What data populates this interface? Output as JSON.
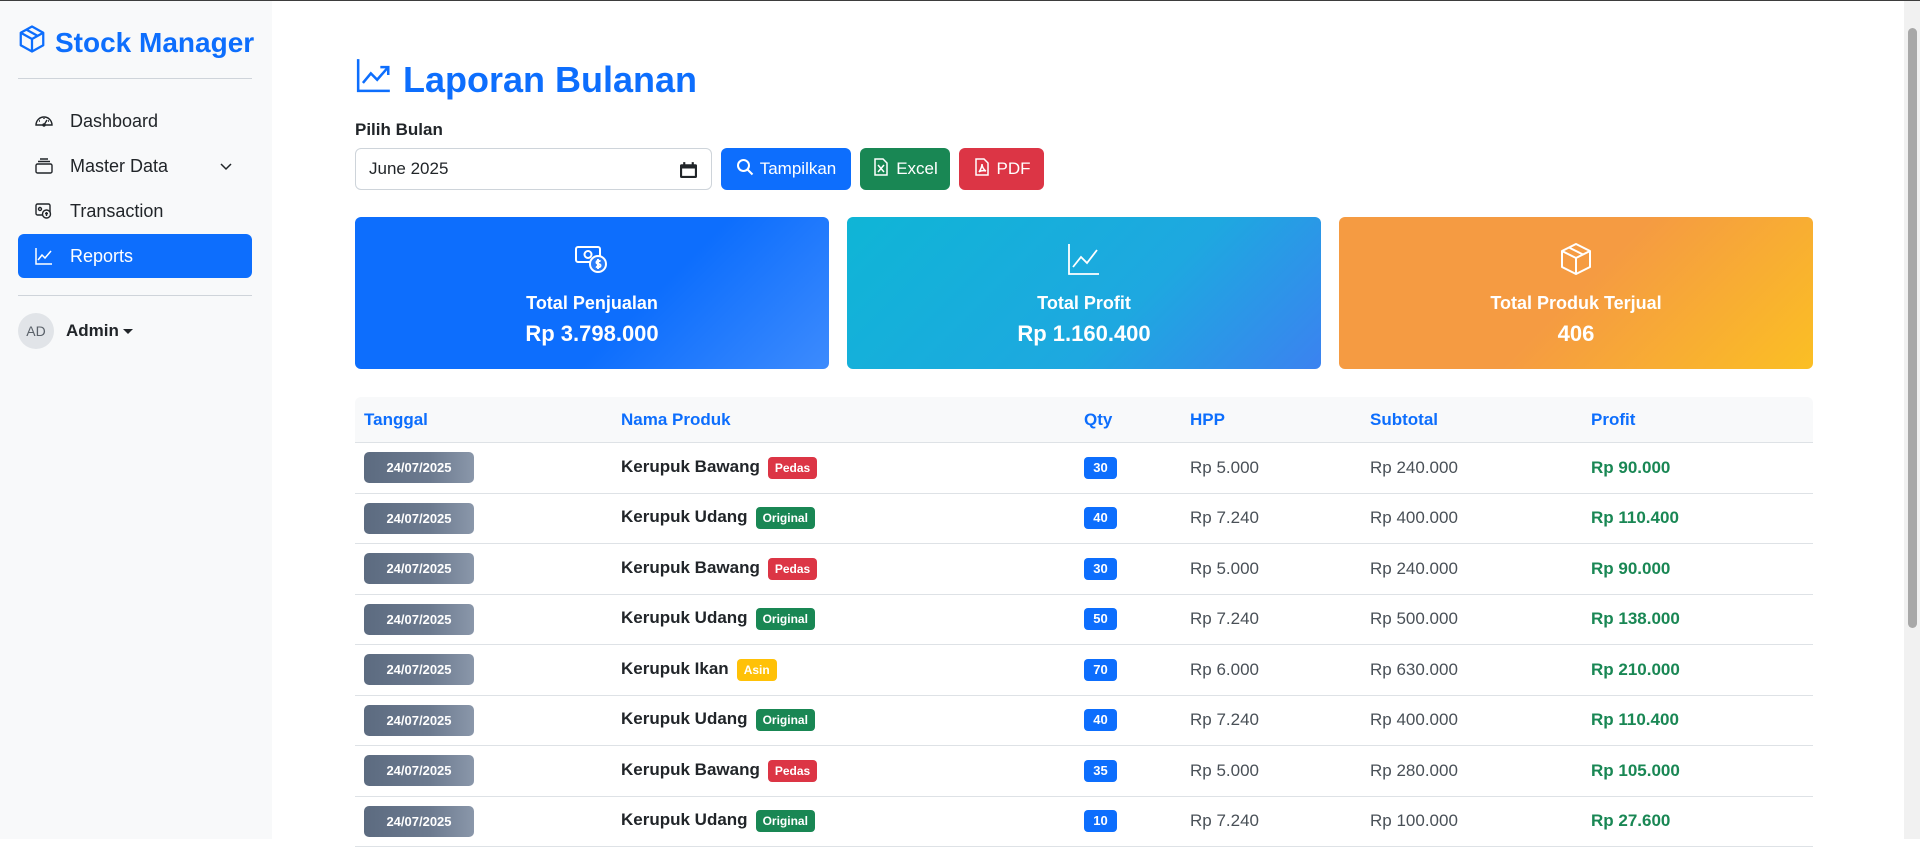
{
  "app": {
    "title": "Stock Manager"
  },
  "sidebar": {
    "items": [
      {
        "label": "Dashboard",
        "icon": "speedometer-icon",
        "active": false
      },
      {
        "label": "Master Data",
        "icon": "stack-icon",
        "active": false,
        "expandable": true
      },
      {
        "label": "Transaction",
        "icon": "cash-register-icon",
        "active": false
      },
      {
        "label": "Reports",
        "icon": "chart-line-icon",
        "active": true
      }
    ],
    "user": {
      "initials": "AD",
      "name": "Admin"
    }
  },
  "page": {
    "title": "Laporan Bulanan",
    "month_label": "Pilih Bulan",
    "month_value": "June 2025",
    "buttons": {
      "show": "Tampilkan",
      "excel": "Excel",
      "pdf": "PDF"
    }
  },
  "summary": [
    {
      "label": "Total Penjualan",
      "value": "Rp 3.798.000",
      "icon": "cash-coin-icon"
    },
    {
      "label": "Total Profit",
      "value": "Rp 1.160.400",
      "icon": "graph-up-icon"
    },
    {
      "label": "Total Produk Terjual",
      "value": "406",
      "icon": "box-icon"
    }
  ],
  "table": {
    "columns": [
      "Tanggal",
      "Nama Produk",
      "Qty",
      "HPP",
      "Subtotal",
      "Profit"
    ],
    "rows": [
      {
        "date": "24/07/2025",
        "name": "Kerupuk Bawang",
        "tag": "Pedas",
        "tag_color": "#dc3545",
        "qty": "30",
        "hpp": "Rp 5.000",
        "subtotal": "Rp 240.000",
        "profit": "Rp 90.000"
      },
      {
        "date": "24/07/2025",
        "name": "Kerupuk Udang",
        "tag": "Original",
        "tag_color": "#198754",
        "qty": "40",
        "hpp": "Rp 7.240",
        "subtotal": "Rp 400.000",
        "profit": "Rp 110.400"
      },
      {
        "date": "24/07/2025",
        "name": "Kerupuk Bawang",
        "tag": "Pedas",
        "tag_color": "#dc3545",
        "qty": "30",
        "hpp": "Rp 5.000",
        "subtotal": "Rp 240.000",
        "profit": "Rp 90.000"
      },
      {
        "date": "24/07/2025",
        "name": "Kerupuk Udang",
        "tag": "Original",
        "tag_color": "#198754",
        "qty": "50",
        "hpp": "Rp 7.240",
        "subtotal": "Rp 500.000",
        "profit": "Rp 138.000"
      },
      {
        "date": "24/07/2025",
        "name": "Kerupuk Ikan",
        "tag": "Asin",
        "tag_color": "#ffc107",
        "qty": "70",
        "hpp": "Rp 6.000",
        "subtotal": "Rp 630.000",
        "profit": "Rp 210.000"
      },
      {
        "date": "24/07/2025",
        "name": "Kerupuk Udang",
        "tag": "Original",
        "tag_color": "#198754",
        "qty": "40",
        "hpp": "Rp 7.240",
        "subtotal": "Rp 400.000",
        "profit": "Rp 110.400"
      },
      {
        "date": "24/07/2025",
        "name": "Kerupuk Bawang",
        "tag": "Pedas",
        "tag_color": "#dc3545",
        "qty": "35",
        "hpp": "Rp 5.000",
        "subtotal": "Rp 280.000",
        "profit": "Rp 105.000"
      },
      {
        "date": "24/07/2025",
        "name": "Kerupuk Udang",
        "tag": "Original",
        "tag_color": "#198754",
        "qty": "10",
        "hpp": "Rp 7.240",
        "subtotal": "Rp 100.000",
        "profit": "Rp 27.600"
      }
    ]
  },
  "colors": {
    "primary": "#0d6efd",
    "success": "#198754",
    "danger": "#dc3545",
    "warning": "#ffc107"
  }
}
